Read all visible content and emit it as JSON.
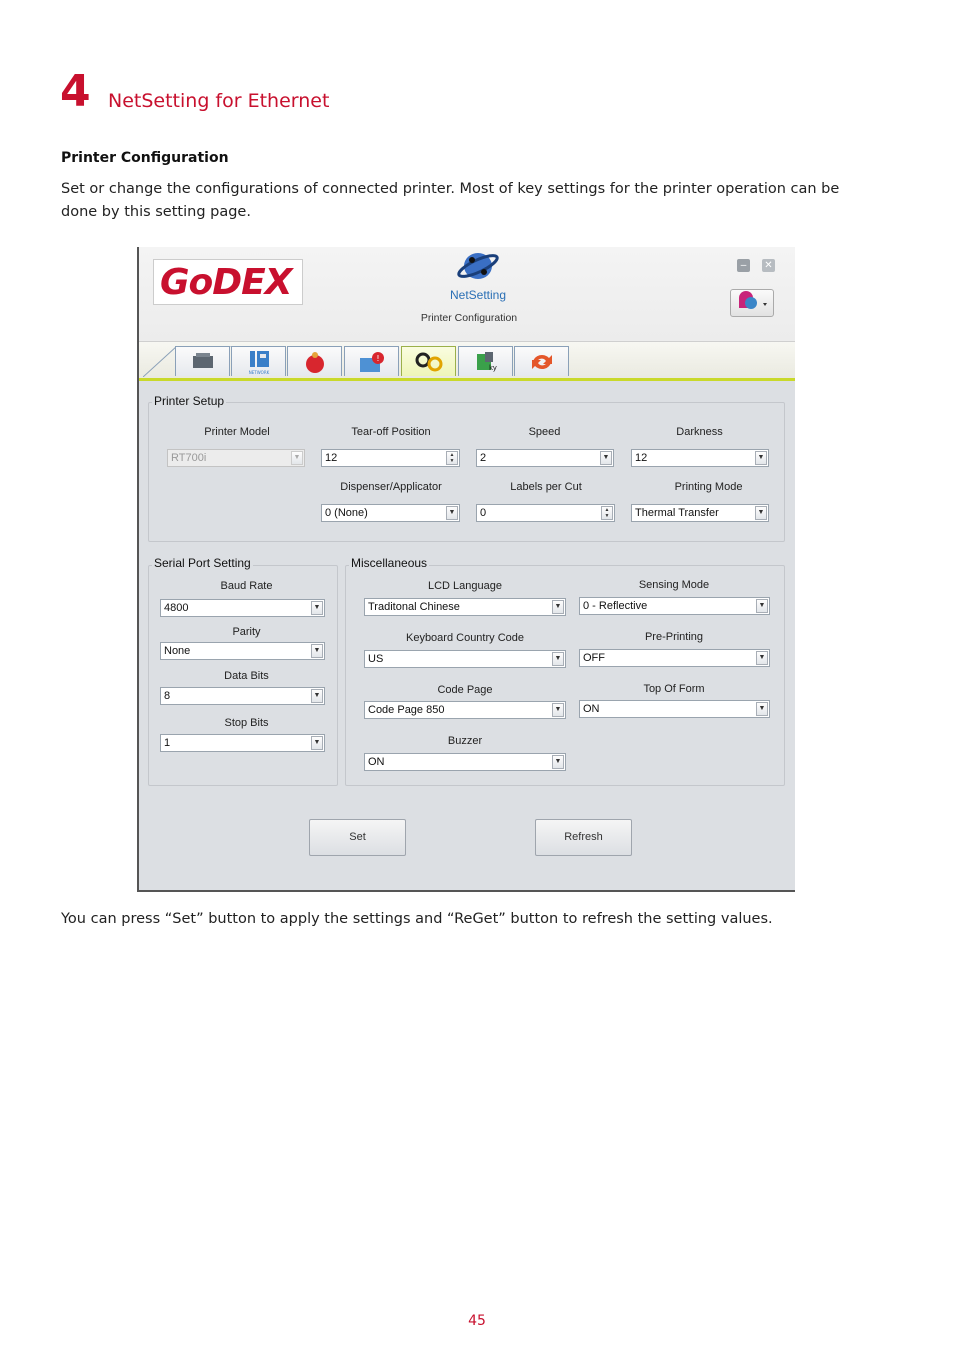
{
  "chapter": {
    "number": "4",
    "title": "NetSetting for Ethernet"
  },
  "section": {
    "title": "Printer Configuration",
    "intro": "Set or change the configurations of connected printer. Most of key settings for the printer operation can be done by this setting page."
  },
  "app": {
    "logo": "GoDEX",
    "name": "NetSetting",
    "subtitle": "Printer Configuration",
    "tabs": [
      {
        "icon": "printer-icon"
      },
      {
        "icon": "ip-network-icon",
        "label": "NETWORK"
      },
      {
        "icon": "alert-bell-icon"
      },
      {
        "icon": "email-alert-icon"
      },
      {
        "icon": "gears-icon"
      },
      {
        "icon": "key-icon"
      },
      {
        "icon": "refresh-icon"
      }
    ],
    "printer_setup": {
      "title": "Printer Setup",
      "printer_model": {
        "label": "Printer Model",
        "value": "RT700i"
      },
      "tearoff": {
        "label": "Tear-off  Position",
        "value": "12"
      },
      "speed": {
        "label": "Speed",
        "value": "2"
      },
      "darkness": {
        "label": "Darkness",
        "value": "12"
      },
      "dispenser": {
        "label": "Dispenser/Applicator",
        "value": "0 (None)"
      },
      "labels_per_cut": {
        "label": "Labels  per Cut",
        "value": "0"
      },
      "printing_mode": {
        "label": "Printing Mode",
        "value": "Thermal Transfer"
      }
    },
    "serial": {
      "title": "Serial Port Setting",
      "baud": {
        "label": "Baud Rate",
        "value": "4800"
      },
      "parity": {
        "label": "Parity",
        "value": "None"
      },
      "data_bits": {
        "label": "Data Bits",
        "value": "8"
      },
      "stop_bits": {
        "label": "Stop Bits",
        "value": "1"
      }
    },
    "misc": {
      "title": "Miscellaneous",
      "lcd": {
        "label": "LCD Language",
        "value": "Traditonal Chinese"
      },
      "sensing": {
        "label": "Sensing Mode",
        "value": "0 - Reflective"
      },
      "keyboard": {
        "label": "Keyboard Country Code",
        "value": "US"
      },
      "preprint": {
        "label": "Pre-Printing",
        "value": "OFF"
      },
      "codepage": {
        "label": "Code Page",
        "value": "Code Page 850"
      },
      "topform": {
        "label": "Top Of Form",
        "value": "ON"
      },
      "buzzer": {
        "label": "Buzzer",
        "value": "ON"
      }
    },
    "buttons": {
      "set": "Set",
      "refresh": "Refresh"
    }
  },
  "footer_text": "You can press “Set” button to apply the settings and “ReGet” button to refresh the setting values.",
  "page_number": "45"
}
